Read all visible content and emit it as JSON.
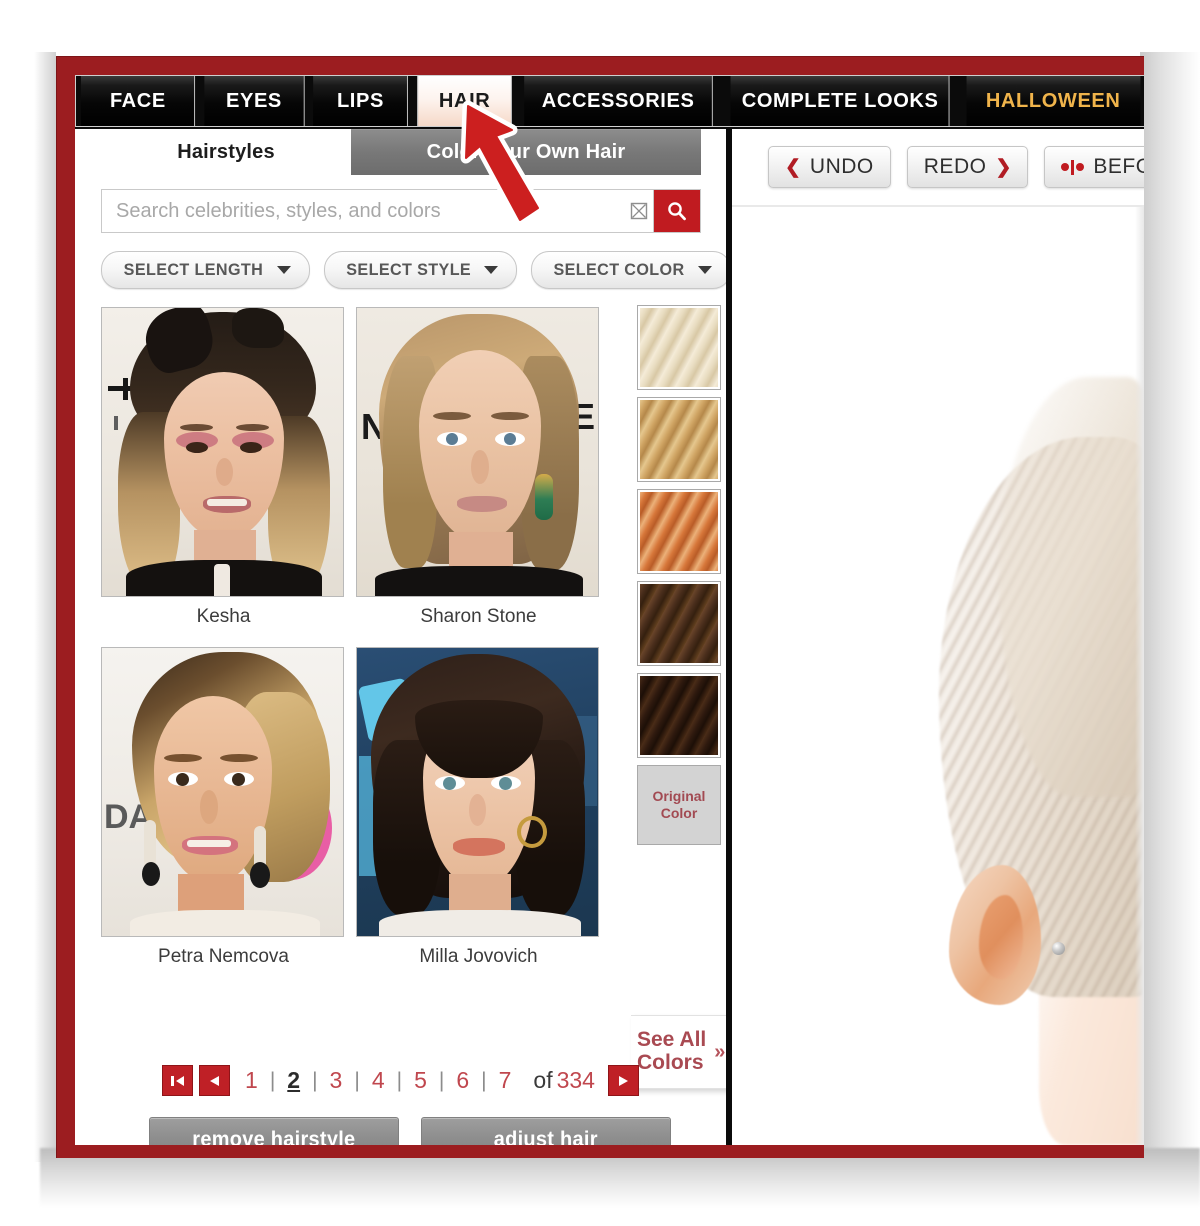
{
  "window": {
    "frame_color": "#9c1d20"
  },
  "nav": {
    "tabs": [
      {
        "label": "FACE",
        "active": false
      },
      {
        "label": "EYES",
        "active": false
      },
      {
        "label": "LIPS",
        "active": false
      },
      {
        "label": "HAIR",
        "active": true
      },
      {
        "label": "ACCESSORIES",
        "active": false
      },
      {
        "label": "COMPLETE LOOKS",
        "active": false
      },
      {
        "label": "HALLOWEEN",
        "active": false,
        "accent": "#f0b44b"
      }
    ]
  },
  "subtabs": {
    "selected": "Hairstyles",
    "unselected": "Color Your Own Hair"
  },
  "search": {
    "placeholder": "Search celebrities, styles, and colors",
    "value": "",
    "clear_icon": "clear-x-icon",
    "search_icon": "magnifier-icon",
    "button_color": "#c01b20"
  },
  "filters": [
    {
      "label": "SELECT LENGTH",
      "icon": "chevron-down-icon"
    },
    {
      "label": "SELECT STYLE",
      "icon": "chevron-down-icon"
    },
    {
      "label": "SELECT COLOR",
      "icon": "chevron-down-icon"
    }
  ],
  "gallery": {
    "items": [
      {
        "name": "Kesha"
      },
      {
        "name": "Sharon Stone"
      },
      {
        "name": "Petra Nemcova"
      },
      {
        "name": "Milla Jovovich"
      }
    ]
  },
  "swatches": {
    "colors": [
      {
        "name": "light-blonde",
        "hex": "#e8dcc3"
      },
      {
        "name": "golden-blonde",
        "hex": "#d2a163"
      },
      {
        "name": "copper-auburn",
        "hex": "#d7773a"
      },
      {
        "name": "medium-brown",
        "hex": "#4a2e1c"
      },
      {
        "name": "dark-brown",
        "hex": "#2e190e"
      }
    ],
    "original_line1": "Original",
    "original_line2": "Color"
  },
  "see_all": {
    "line1": "See All",
    "line2": "Colors",
    "arrow": "»"
  },
  "pagination": {
    "first_icon": "first-page-icon",
    "prev_icon": "prev-page-icon",
    "next_icon": "next-page-icon",
    "pages": [
      "1",
      "2",
      "3",
      "4",
      "5",
      "6",
      "7"
    ],
    "current": "2",
    "separator": "|",
    "of_label": "of",
    "total": "334"
  },
  "actions": {
    "remove": "remove hairstyle",
    "adjust": "adjust hair"
  },
  "toolbar": {
    "undo": "UNDO",
    "redo": "REDO",
    "before": "BEFORE",
    "undo_icon": "chevron-left-icon",
    "redo_icon": "chevron-right-icon",
    "before_icon": "before-after-slider-icon"
  },
  "annotation": {
    "arrow": "red-pointer-arrow",
    "points_to": "HAIR"
  }
}
